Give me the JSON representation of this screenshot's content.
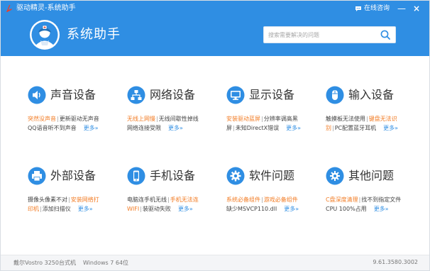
{
  "titlebar": {
    "app_title": "驱动精灵-系统助手",
    "consult_label": "在线咨询",
    "minimize_label": "—",
    "close_label": "×"
  },
  "header": {
    "brand_title": "系统助手",
    "search_placeholder": "搜索需要解决的问题"
  },
  "colors": {
    "header_blue": "#2f8ee3",
    "icon_blue": "#2f8ee3",
    "link_orange": "#f27b23",
    "more_blue": "#2f8ee3"
  },
  "cards": [
    {
      "title": "声音设备",
      "icon": "speaker-icon",
      "lines": [
        [
          {
            "text": "突然没声音",
            "orange": true
          },
          {
            "text": "更新驱动无声音"
          }
        ],
        [
          {
            "text": "QQ语音听不到声音"
          }
        ]
      ],
      "more": "更多»"
    },
    {
      "title": "网络设备",
      "icon": "network-icon",
      "lines": [
        [
          {
            "text": "无线上网慢",
            "orange": true
          },
          {
            "text": "无线间歇性掉线"
          }
        ],
        [
          {
            "text": "网络连接受限"
          }
        ]
      ],
      "more": "更多»"
    },
    {
      "title": "显示设备",
      "icon": "monitor-icon",
      "lines": [
        [
          {
            "text": "安装驱动蓝屏",
            "orange": true
          },
          {
            "text": "分辨率调高黑"
          }
        ],
        [
          {
            "text": "屏"
          },
          {
            "text": "未知DirectX错误"
          }
        ]
      ],
      "more": "更多»"
    },
    {
      "title": "输入设备",
      "icon": "mouse-icon",
      "lines": [
        [
          {
            "text": "触摸板无法使用"
          },
          {
            "text": "键盘无法识",
            "orange": true
          }
        ],
        [
          {
            "text": "别",
            "orange": true
          },
          {
            "text": "PC配置蓝牙耳机"
          }
        ]
      ],
      "more": "更多»"
    },
    {
      "title": "外部设备",
      "icon": "printer-icon",
      "lines": [
        [
          {
            "text": "摄像头像素不对"
          },
          {
            "text": "安装网络打",
            "orange": true
          }
        ],
        [
          {
            "text": "印机",
            "orange": true
          },
          {
            "text": "添加扫描仪"
          }
        ]
      ],
      "more": "更多»"
    },
    {
      "title": "手机设备",
      "icon": "phone-icon",
      "lines": [
        [
          {
            "text": "电脑连手机无线"
          },
          {
            "text": "手机无法连",
            "orange": true
          }
        ],
        [
          {
            "text": "WIFI",
            "orange": true
          },
          {
            "text": "装驱动失败"
          }
        ]
      ],
      "more": "更多»"
    },
    {
      "title": "软件问题",
      "icon": "gear-icon",
      "lines": [
        [
          {
            "text": "系统必备组件",
            "orange": true
          },
          {
            "text": "游戏必备组件",
            "orange": true
          }
        ],
        [
          {
            "text": "缺少MSVCP110.dll"
          }
        ]
      ],
      "more": "更多»"
    },
    {
      "title": "其他问题",
      "icon": "settings-icon",
      "lines": [
        [
          {
            "text": "C盘深度清理",
            "orange": true
          },
          {
            "text": "找不到指定文件"
          }
        ],
        [
          {
            "text": "CPU 100%占用"
          }
        ]
      ],
      "more": "更多»"
    }
  ],
  "footer": {
    "computer_model": "戴尔Vostro 3250台式机",
    "os": "Windows 7 64位",
    "version": "9.61.3580.3002"
  }
}
